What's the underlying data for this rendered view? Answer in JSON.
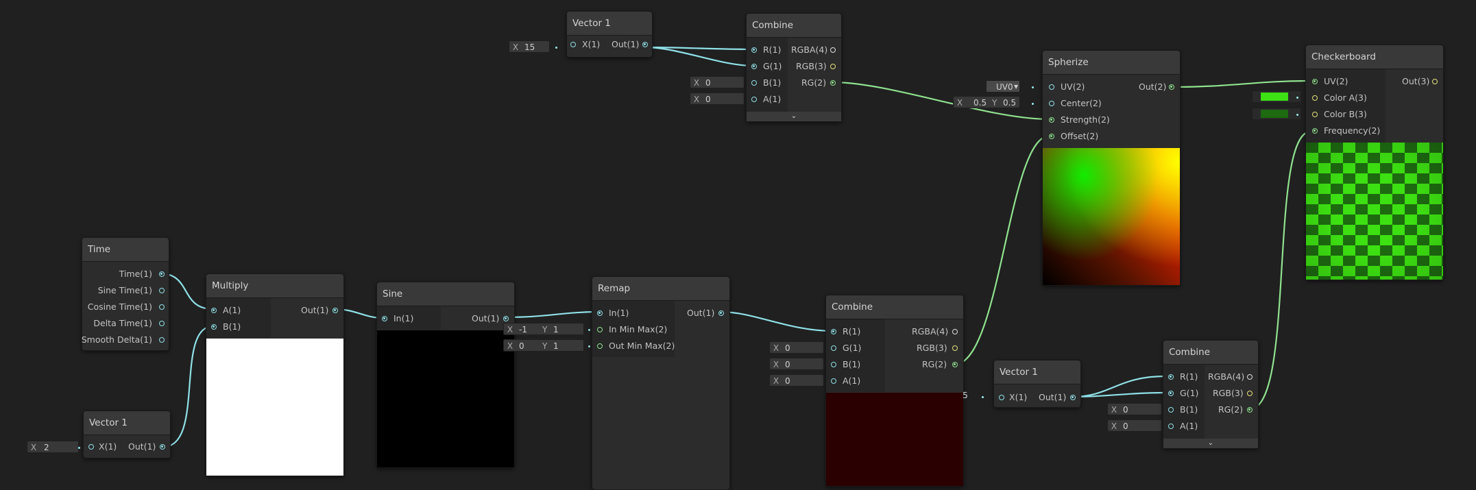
{
  "nodes": {
    "vector1_top": {
      "title": "Vector 1",
      "x_label": "X",
      "x_value": "15",
      "in_label": "X(1)",
      "out_label": "Out(1)"
    },
    "combine_top": {
      "title": "Combine",
      "inputs": [
        "R(1)",
        "G(1)",
        "B(1)",
        "A(1)"
      ],
      "outputs": [
        "RGBA(4)",
        "RGB(3)",
        "RG(2)"
      ],
      "b_value": "0",
      "a_value": "0",
      "field_label": "X",
      "expand": "⌄"
    },
    "spherize": {
      "title": "Spherize",
      "inputs": [
        "UV(2)",
        "Center(2)",
        "Strength(2)",
        "Offset(2)"
      ],
      "output": "Out(2)",
      "uv_dropdown": "UV0",
      "center_x": "0.5",
      "center_y": "0.5",
      "x_label": "X",
      "y_label": "Y"
    },
    "checkerboard": {
      "title": "Checkerboard",
      "inputs": [
        "UV(2)",
        "Color A(3)",
        "Color B(3)",
        "Frequency(2)"
      ],
      "output": "Out(3)",
      "color_a": "#3de012",
      "color_b": "#1d6a10"
    },
    "time": {
      "title": "Time",
      "outputs": [
        "Time(1)",
        "Sine Time(1)",
        "Cosine Time(1)",
        "Delta Time(1)",
        "Smooth Delta(1)"
      ]
    },
    "multiply": {
      "title": "Multiply",
      "inputs": [
        "A(1)",
        "B(1)"
      ],
      "output": "Out(1)"
    },
    "vector1_bottom": {
      "title": "Vector 1",
      "x_label": "X",
      "x_value": "2",
      "in_label": "X(1)",
      "out_label": "Out(1)"
    },
    "sine": {
      "title": "Sine",
      "input": "In(1)",
      "output": "Out(1)"
    },
    "remap": {
      "title": "Remap",
      "inputs": [
        "In(1)",
        "In Min Max(2)",
        "Out Min Max(2)"
      ],
      "output": "Out(1)",
      "in_min": "-1",
      "in_max": "1",
      "out_min": "0",
      "out_max": "1",
      "x_label": "X",
      "y_label": "Y"
    },
    "combine_mid": {
      "title": "Combine",
      "inputs": [
        "R(1)",
        "G(1)",
        "B(1)",
        "A(1)"
      ],
      "outputs": [
        "RGBA(4)",
        "RGB(3)",
        "RG(2)"
      ],
      "g_value": "0",
      "b_value": "0",
      "a_value": "0",
      "field_label": "X"
    },
    "vector1_mid": {
      "title": "Vector 1",
      "x_value": "5",
      "in_label": "X(1)",
      "out_label": "Out(1)"
    },
    "combine_right": {
      "title": "Combine",
      "inputs": [
        "R(1)",
        "G(1)",
        "B(1)",
        "A(1)"
      ],
      "outputs": [
        "RGBA(4)",
        "RGB(3)",
        "RG(2)"
      ],
      "b_value": "0",
      "a_value": "0",
      "field_label": "X",
      "expand": "⌄"
    }
  },
  "colors": {
    "graph_background": "#202020",
    "wire_float": "#8fe1e8",
    "wire_vector2": "#8fe28f"
  }
}
